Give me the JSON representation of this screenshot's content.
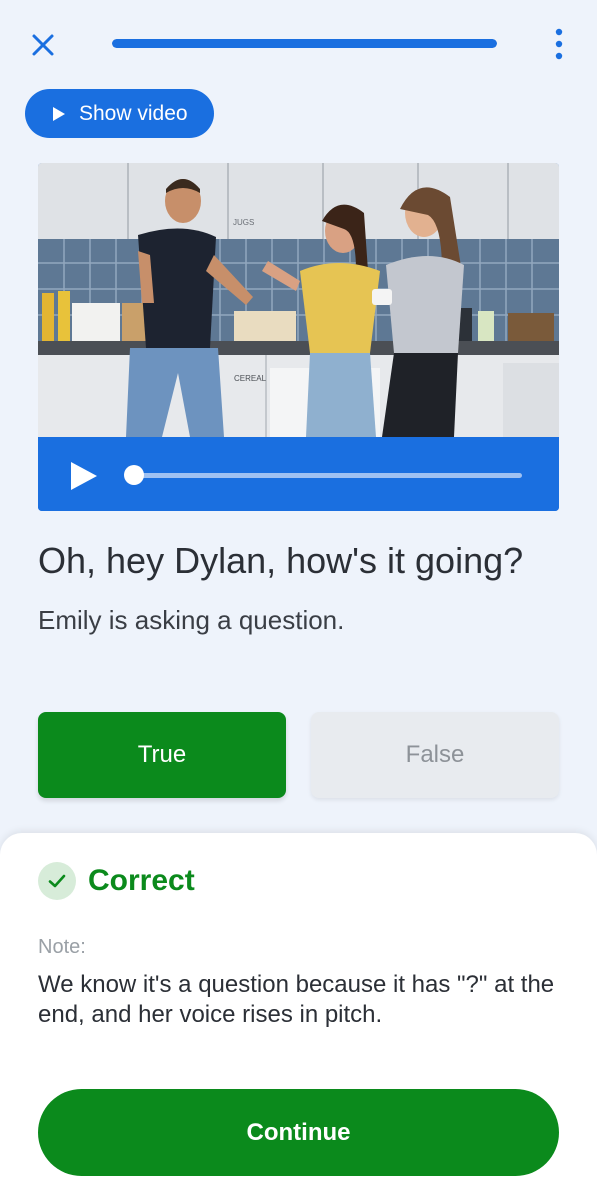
{
  "header": {
    "close_icon": "close-icon",
    "more_icon": "more-vertical-icon",
    "progress_fraction": 1.0
  },
  "video_toggle": {
    "label": "Show video",
    "icon": "play-icon"
  },
  "video": {
    "thumbnail_text_jugs": "JUGS",
    "thumbnail_text_cereal": "CEREAL",
    "playback_position": 0.0,
    "controls_color": "#1a6fe0"
  },
  "question": {
    "prompt": "Oh, hey Dylan, how's it going?",
    "statement": "Emily is asking a question."
  },
  "answers": {
    "true_label": "True",
    "false_label": "False",
    "selected": "True"
  },
  "feedback": {
    "status": "Correct",
    "status_icon": "check-icon",
    "note_label": "Note:",
    "note_text": "We know it's a question because it has \"?\" at the end, and her voice rises in pitch."
  },
  "continue_button": {
    "label": "Continue"
  },
  "colors": {
    "accent_blue": "#1a6fe0",
    "success_green": "#0b8a1c",
    "background": "#eef3fb"
  }
}
